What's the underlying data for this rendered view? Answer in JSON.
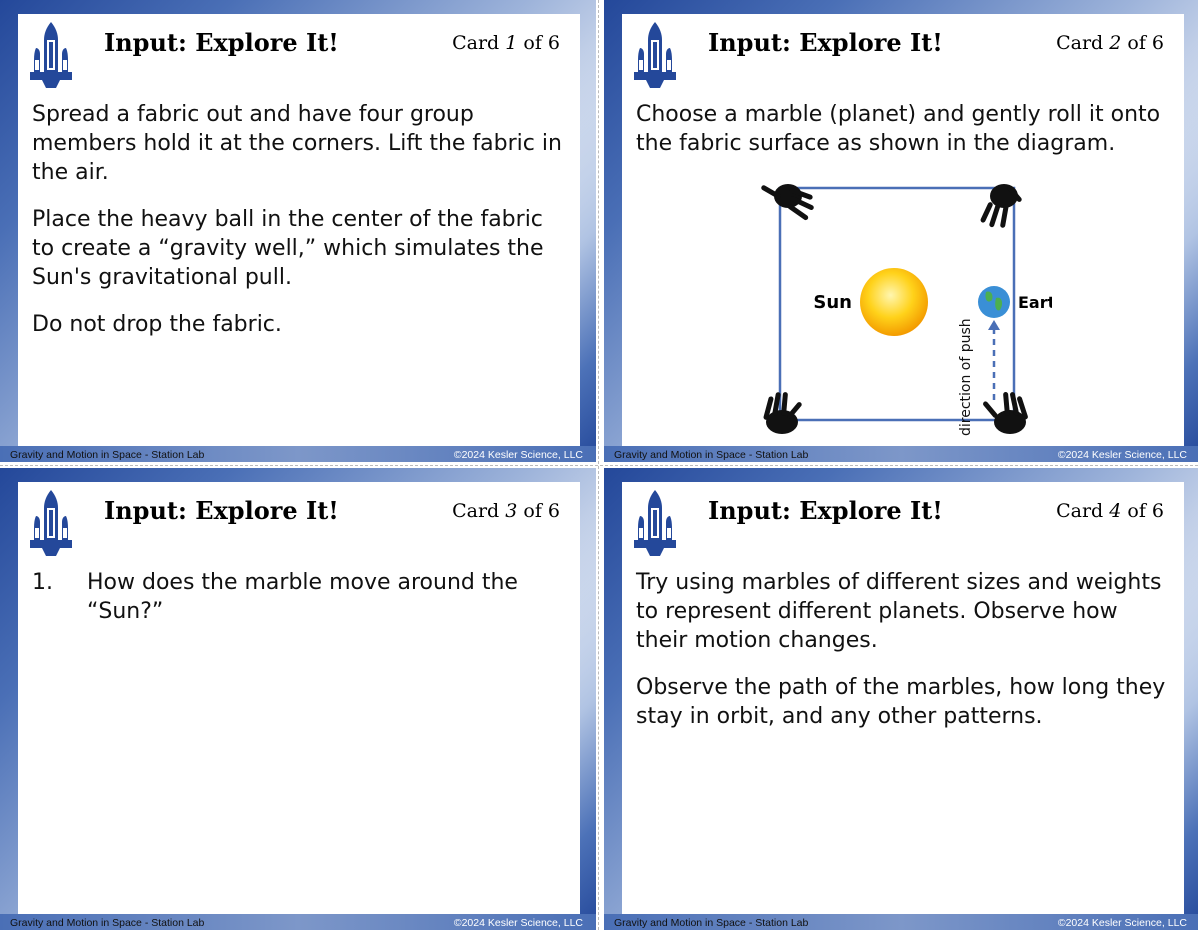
{
  "common": {
    "title": "Input: Explore It!",
    "card_prefix": "Card",
    "card_of": "of 6",
    "footer_left": "Gravity and Motion in Space - Station Lab",
    "footer_right": "©2024 Kesler Science, LLC"
  },
  "cards": [
    {
      "number": "1",
      "paragraphs": [
        "Spread a fabric out and have four group members hold it at the corners. Lift the fabric in the air.",
        "Place the heavy ball in the center of the fabric to create a “gravity well,” which simulates the Sun's gravitational pull.",
        "Do not drop the fabric."
      ]
    },
    {
      "number": "2",
      "paragraphs": [
        "Choose a marble (planet) and gently roll it onto the fabric surface as shown in the diagram."
      ],
      "diagram": {
        "sun_label": "Sun",
        "earth_label": "Earth",
        "push_label": "direction of push"
      }
    },
    {
      "number": "3",
      "question_number": "1.",
      "question": "How does the marble move around the “Sun?”"
    },
    {
      "number": "4",
      "paragraphs": [
        "Try using marbles of different sizes and weights to represent different planets. Observe how their motion changes.",
        "Observe the path of the marbles, how long they stay in orbit, and any other patterns."
      ]
    }
  ],
  "colors": {
    "accent": "#24489a",
    "line": "#4a6fb6",
    "sun": "#f7b500",
    "earth": "#3a8fd6"
  }
}
